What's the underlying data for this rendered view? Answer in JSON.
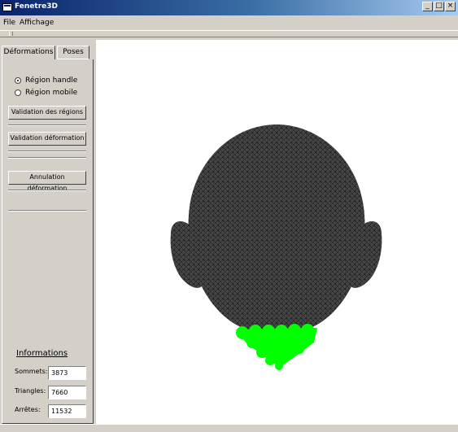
{
  "window": {
    "title": "Fenetre3D",
    "minimize": "_",
    "maximize": "□",
    "close": "×"
  },
  "menu": {
    "file": "File",
    "affichage": "Affichage"
  },
  "tabs": [
    {
      "label": "Déformations"
    },
    {
      "label": "Poses"
    }
  ],
  "radios": [
    {
      "label": "Région handle",
      "checked": true
    },
    {
      "label": "Région mobile",
      "checked": false
    }
  ],
  "buttons": {
    "validation_regions": "Validation des régions",
    "validation_deformation": "Validation déformation",
    "annulation_deformation": "Annulation déformation"
  },
  "informations": {
    "title": "Informations",
    "sommets_label": "Sommets:",
    "sommets_value": "3873",
    "triangles_label": "Triangles:",
    "triangles_value": "7660",
    "arretes_label": "Arrêtes:",
    "arretes_value": "11532"
  },
  "viewport": {
    "mesh_color": "#4a4a4a",
    "wire_color": "#1c1c1c",
    "handle_color": "#00ff00"
  }
}
